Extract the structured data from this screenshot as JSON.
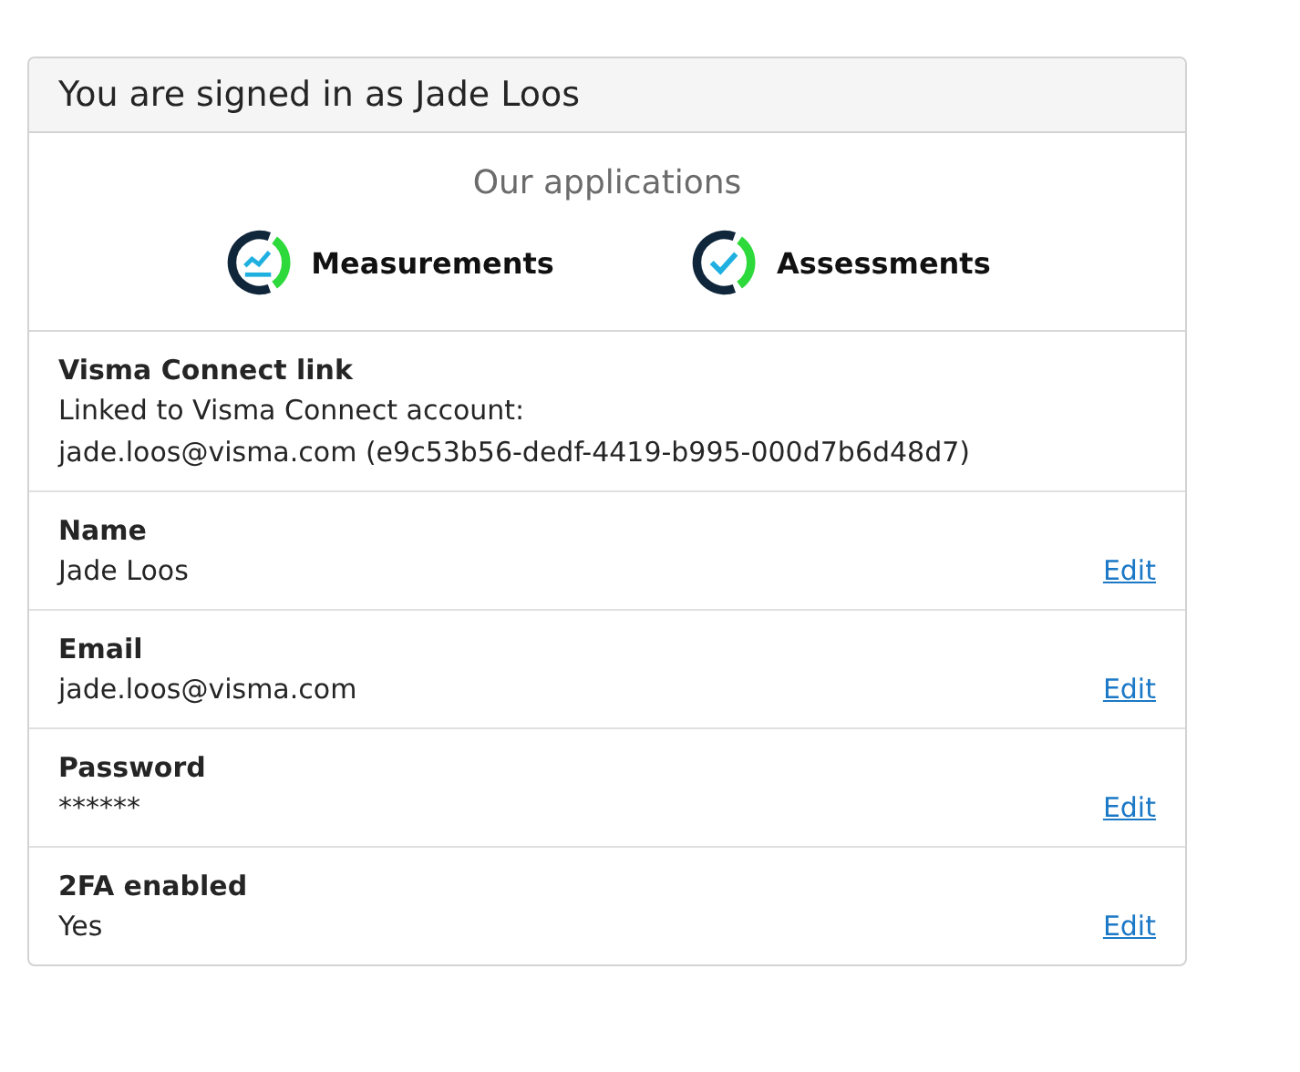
{
  "header": {
    "title": "You are signed in as Jade Loos"
  },
  "applications": {
    "title": "Our applications",
    "items": [
      {
        "label": "Measurements",
        "kind": "chart"
      },
      {
        "label": "Assessments",
        "kind": "check"
      }
    ]
  },
  "sections": [
    {
      "label": "Visma Connect link",
      "lines": [
        "Linked to Visma Connect account:",
        "jade.loos@visma.com (e9c53b56-dedf-4419-b995-000d7b6d48d7)"
      ]
    },
    {
      "label": "Name",
      "lines": [
        "Jade Loos"
      ],
      "action": "Edit"
    },
    {
      "label": "Email",
      "lines": [
        "jade.loos@visma.com"
      ],
      "action": "Edit"
    },
    {
      "label": "Password",
      "lines": [
        "******"
      ],
      "action": "Edit"
    },
    {
      "label": "2FA enabled",
      "lines": [
        "Yes"
      ],
      "action": "Edit"
    }
  ]
}
